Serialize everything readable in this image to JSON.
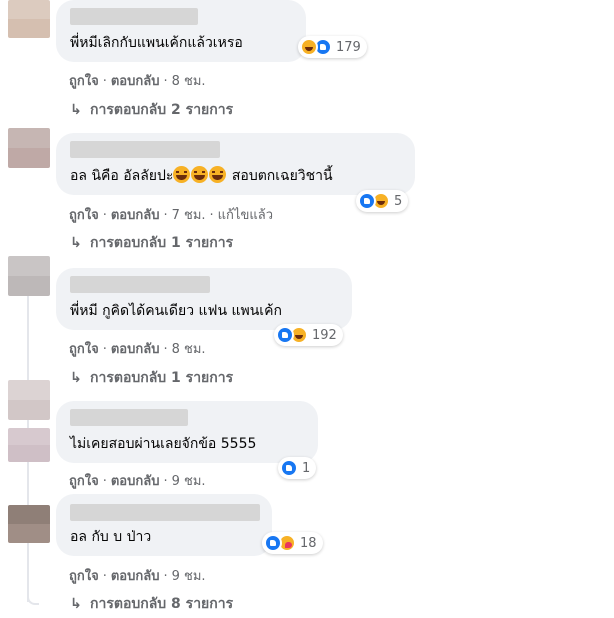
{
  "comments": [
    {
      "text": "พี่หมีเลิกกับแพนเค้กแล้วเหรอ",
      "emoji": "",
      "suffix": "",
      "reaction_count": "179",
      "meta": {
        "like": "ถูกใจ",
        "reply": "ตอบกลับ",
        "time": "8 ชม.",
        "edited": ""
      },
      "replies": "การตอบกลับ 2 รายการ"
    },
    {
      "text": "อล นิคือ อัลลัยปะ",
      "emoji": "🤣🤣🤣",
      "suffix": " สอบตกเฉยวิชานี้",
      "reaction_count": "5",
      "meta": {
        "like": "ถูกใจ",
        "reply": "ตอบกลับ",
        "time": "7 ชม.",
        "edited": "แก้ไขแล้ว"
      },
      "replies": "การตอบกลับ 1 รายการ"
    },
    {
      "text": "พี่หมี กูคิดได้คนเดียว แฟน แพนเค้ก",
      "emoji": "",
      "suffix": "",
      "reaction_count": "192",
      "meta": {
        "like": "ถูกใจ",
        "reply": "ตอบกลับ",
        "time": "8 ชม.",
        "edited": ""
      },
      "replies": "การตอบกลับ 1 รายการ"
    },
    {
      "text": "ไม่เคยสอบผ่านเลยจักข้อ 5555",
      "emoji": "",
      "suffix": "",
      "reaction_count": "1",
      "meta": {
        "like": "ถูกใจ",
        "reply": "ตอบกลับ",
        "time": "9 ชม.",
        "edited": ""
      },
      "replies": ""
    },
    {
      "text": "อล กับ บ ป่าว",
      "emoji": "",
      "suffix": "",
      "reaction_count": "18",
      "meta": {
        "like": "ถูกใจ",
        "reply": "ตอบกลับ",
        "time": "9 ชม.",
        "edited": ""
      },
      "replies": "การตอบกลับ 8 รายการ"
    }
  ],
  "colors": {
    "bubble": "#f0f2f5",
    "meta_text": "#65676b",
    "like_blue": "#1877f2",
    "haha_yellow": "#f7b125"
  },
  "icons": [
    "like-icon",
    "haha-icon",
    "care-icon",
    "reply-arrow-icon"
  ]
}
